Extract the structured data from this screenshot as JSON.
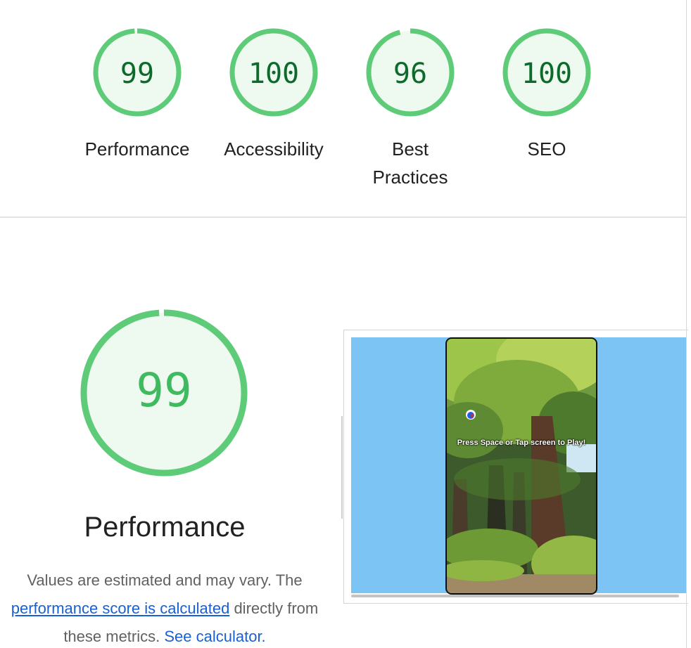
{
  "gauges": [
    {
      "score": "99",
      "label": "Performance",
      "value": 99
    },
    {
      "score": "100",
      "label": "Accessibility",
      "value": 100
    },
    {
      "score": "96",
      "label_line1": "Best",
      "label_line2": "Practices",
      "value": 96
    },
    {
      "score": "100",
      "label": "SEO",
      "value": 100
    }
  ],
  "performance": {
    "score": "99",
    "value": 99,
    "title": "Performance",
    "desc_prefix": "Values are estimated and may vary. The ",
    "desc_link": "performance score is calculated",
    "desc_middle": " directly from these metrics. ",
    "desc_calc_link": "See calculator."
  },
  "screenshot": {
    "game_text": "Press Space or Tap screen to Play!"
  },
  "colors": {
    "pass": "#0c6b2a",
    "pass_ring": "#5ecb78",
    "pass_fill": "#eef9f0",
    "link": "#1a5fd4"
  }
}
